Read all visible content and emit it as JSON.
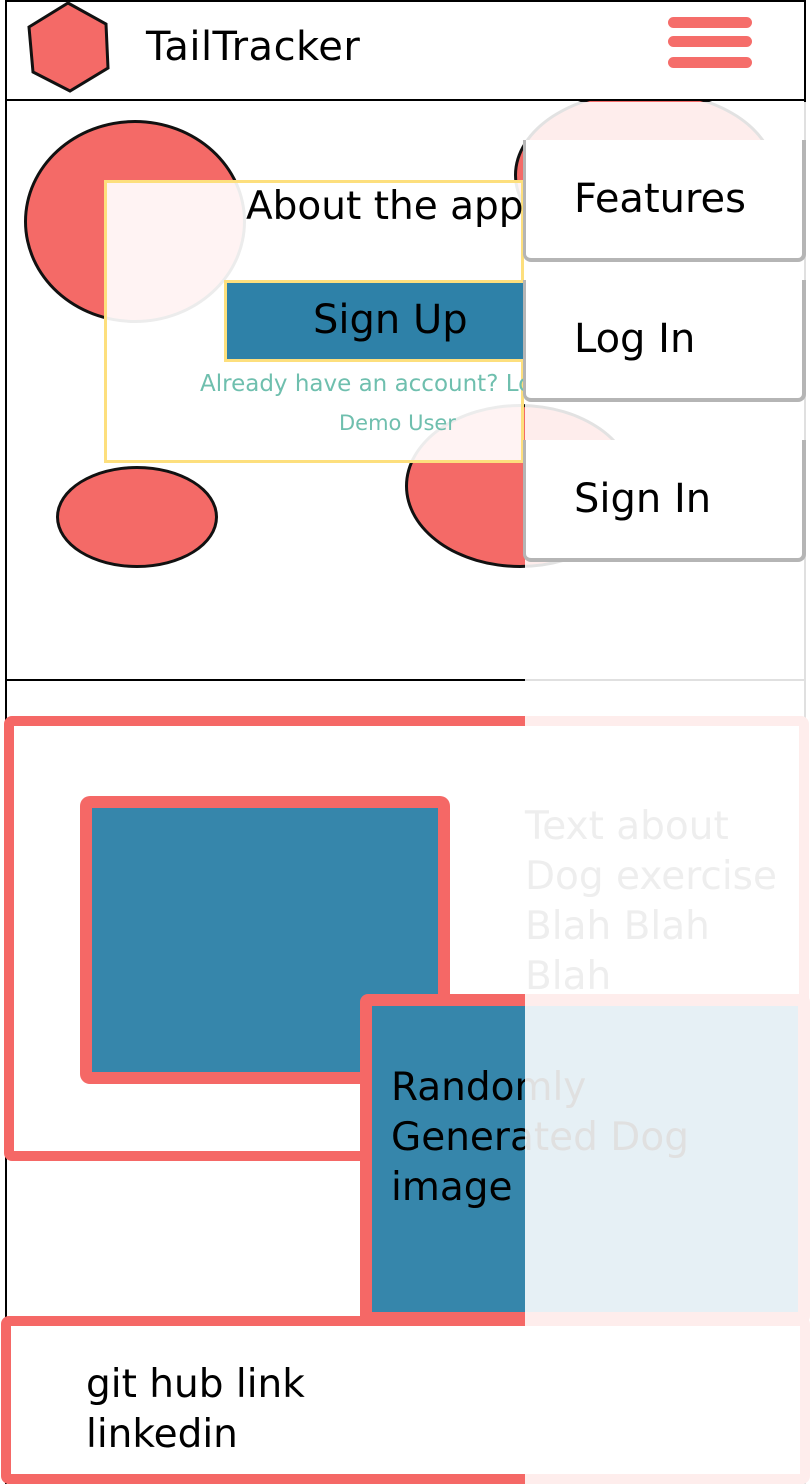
{
  "header": {
    "app_title": "TailTracker",
    "logo_icon": "hexagon-logo-icon",
    "menu_icon": "hamburger-menu-icon"
  },
  "hero": {
    "about_title": "About the app",
    "signup_label": "Sign Up",
    "already_account": "Already have an account? Log In",
    "demo_user": "Demo User"
  },
  "feature": {
    "dog_text_lines": [
      "Text about",
      "Dog exercise",
      "Blah Blah",
      "Blah"
    ],
    "image_caption_lines": [
      "Randomly",
      "Generated Dog",
      "image"
    ]
  },
  "footer": {
    "lines": [
      "git hub link",
      "linkedin"
    ]
  },
  "nav_menu": {
    "items": [
      {
        "label": "Features"
      },
      {
        "label": "Log In"
      },
      {
        "label": "Sign In"
      }
    ]
  },
  "colors": {
    "accent_red": "#f56866",
    "primary_blue": "#2e81a8",
    "border_yellow": "#fddf7d",
    "link_teal": "#6fbfae"
  }
}
